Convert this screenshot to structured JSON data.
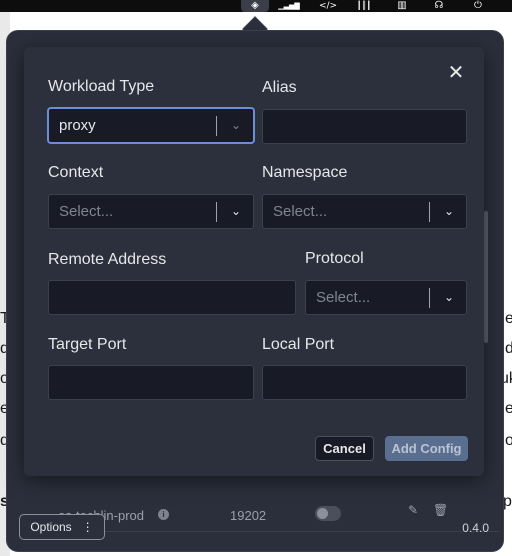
{
  "menubar": {
    "icons": [
      {
        "name": "app-status-icon",
        "glyph": "◈"
      },
      {
        "name": "signal-bars-icon",
        "glyph": "▁▃▅▇"
      },
      {
        "name": "code-shield-icon",
        "glyph": "</>"
      },
      {
        "name": "audio-waveform-icon",
        "glyph": "┃║┃"
      },
      {
        "name": "window-layout-icon",
        "glyph": "▥"
      },
      {
        "name": "broadcast-icon",
        "glyph": "☊"
      },
      {
        "name": "power-icon",
        "glyph": "⏻"
      }
    ]
  },
  "background": {
    "fragments": [
      "e",
      "d",
      "uk",
      "e",
      "o",
      "s",
      "p",
      "T",
      "d",
      "o",
      "e",
      "d"
    ]
  },
  "popover": {
    "row": {
      "name": "es-techlin-prod",
      "info_icon": "i",
      "port": "19202",
      "edit_icon": "✎",
      "delete_icon": "🗑"
    },
    "options_label": "Options",
    "options_icon": "⋮",
    "version": "0.4.0"
  },
  "modal": {
    "close_icon": "✕",
    "workload_type": {
      "label": "Workload Type",
      "value": "proxy"
    },
    "alias": {
      "label": "Alias",
      "value": ""
    },
    "context": {
      "label": "Context",
      "placeholder": "Select..."
    },
    "namespace": {
      "label": "Namespace",
      "placeholder": "Select..."
    },
    "remote_address": {
      "label": "Remote Address",
      "value": ""
    },
    "protocol": {
      "label": "Protocol",
      "placeholder": "Select..."
    },
    "target_port": {
      "label": "Target Port",
      "value": ""
    },
    "local_port": {
      "label": "Local Port",
      "value": ""
    },
    "cancel_label": "Cancel",
    "add_label": "Add Config"
  },
  "colors": {
    "modal_bg": "#2c303c",
    "input_bg": "#181b26",
    "focus_border": "#6b8ed6",
    "add_button_bg": "#5a6f8f"
  }
}
